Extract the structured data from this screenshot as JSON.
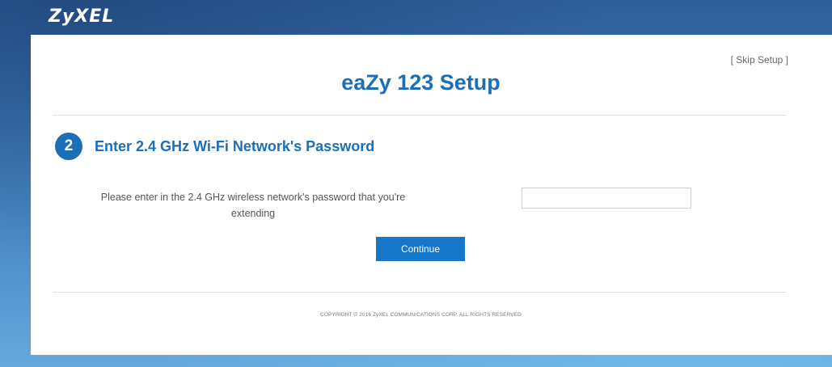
{
  "brand": {
    "logo_text": "ZyXEL"
  },
  "header": {
    "skip_label": "[ Skip Setup ]",
    "title": "eaZy 123 Setup"
  },
  "step": {
    "number": "2",
    "title": "Enter 2.4 GHz Wi-Fi Network's Password"
  },
  "form": {
    "prompt_line1": "Please enter in the 2.4 GHz wireless network's password that you're",
    "prompt_line2": "extending",
    "password_value": "",
    "continue_label": "Continue"
  },
  "footer": {
    "copyright": "COPYRIGHT © 2016 ZyXEL COMMUNICATIONS CORP. ALL RIGHTS RESERVED"
  },
  "colors": {
    "accent": "#1a6fb8",
    "button": "#1677c9",
    "background_top": "#2e5f9a",
    "background_bottom": "#66a9dd"
  }
}
